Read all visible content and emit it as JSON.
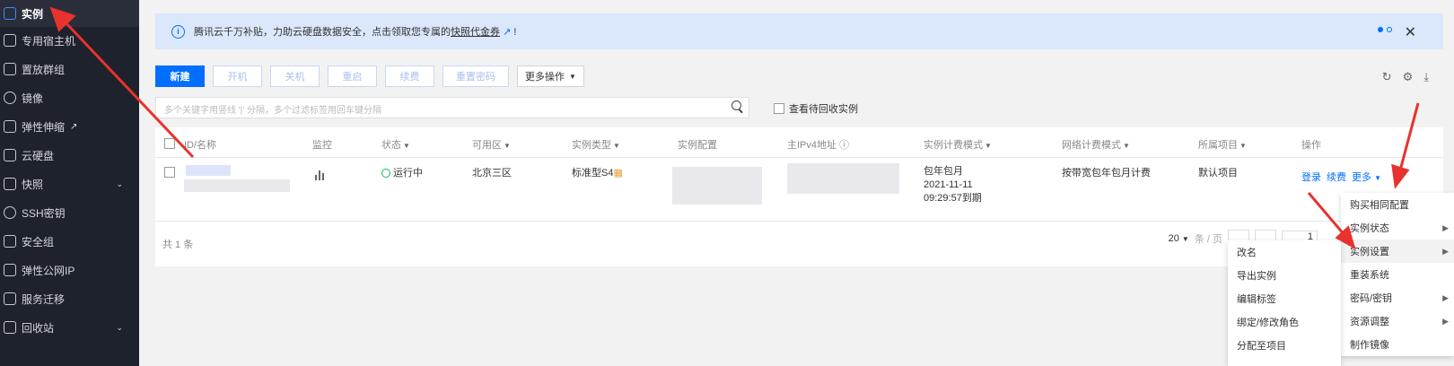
{
  "sidebar": {
    "items": [
      {
        "label": "实例",
        "active": true
      },
      {
        "label": "专用宿主机"
      },
      {
        "label": "置放群组"
      },
      {
        "label": "镜像"
      },
      {
        "label": "弹性伸缩",
        "external": true
      },
      {
        "label": "云硬盘"
      },
      {
        "label": "快照",
        "expandable": true
      },
      {
        "label": "SSH密钥"
      },
      {
        "label": "安全组"
      },
      {
        "label": "弹性公网IP"
      },
      {
        "label": "服务迁移"
      },
      {
        "label": "回收站",
        "expandable": true
      }
    ]
  },
  "notice": {
    "text": "腾讯云千万补贴，力助云硬盘数据安全，点击领取您专属的",
    "link": "快照代金券",
    "suffix": "!"
  },
  "toolbar": {
    "new": "新建",
    "start": "开机",
    "stop": "关机",
    "restart": "重启",
    "renew": "续费",
    "reset_pwd": "重置密码",
    "more": "更多操作"
  },
  "search": {
    "placeholder": "多个关键字用竖线 '|' 分隔，多个过滤标签用回车键分隔",
    "recycle_label": "查看待回收实例"
  },
  "table": {
    "headers": [
      "ID/名称",
      "监控",
      "状态",
      "可用区",
      "实例类型",
      "实例配置",
      "主IPv4地址",
      "实例计费模式",
      "网络计费模式",
      "所属项目",
      "操作"
    ],
    "row": {
      "status": "运行中",
      "zone": "北京三区",
      "type": "标准型S4",
      "billing_1": "包年包月",
      "billing_2": "2021-11-11",
      "billing_3": "09:29:57到期",
      "network_billing": "按带宽包年包月计费",
      "project": "默认项目",
      "op_login": "登录",
      "op_renew": "续费",
      "op_more": "更多"
    },
    "total": "共 1 条",
    "page_size": "20",
    "per_page": "条 / 页",
    "page": "1"
  },
  "menu_main": {
    "items": [
      {
        "label": "购买相同配置"
      },
      {
        "label": "实例状态",
        "sub": true
      },
      {
        "label": "实例设置",
        "sub": true,
        "highlight": true
      },
      {
        "label": "重装系统"
      },
      {
        "label": "密码/密钥",
        "sub": true
      },
      {
        "label": "资源调整",
        "sub": true
      },
      {
        "label": "制作镜像"
      }
    ]
  },
  "menu_sub": {
    "items": [
      {
        "label": "改名"
      },
      {
        "label": "导出实例"
      },
      {
        "label": "编辑标签"
      },
      {
        "label": "绑定/修改角色"
      },
      {
        "label": "分配至项目"
      }
    ]
  },
  "colors": {
    "accent": "#006eff",
    "sidebar": "#1e222d",
    "arrow": "#e8322d",
    "running": "#0abf5b"
  }
}
